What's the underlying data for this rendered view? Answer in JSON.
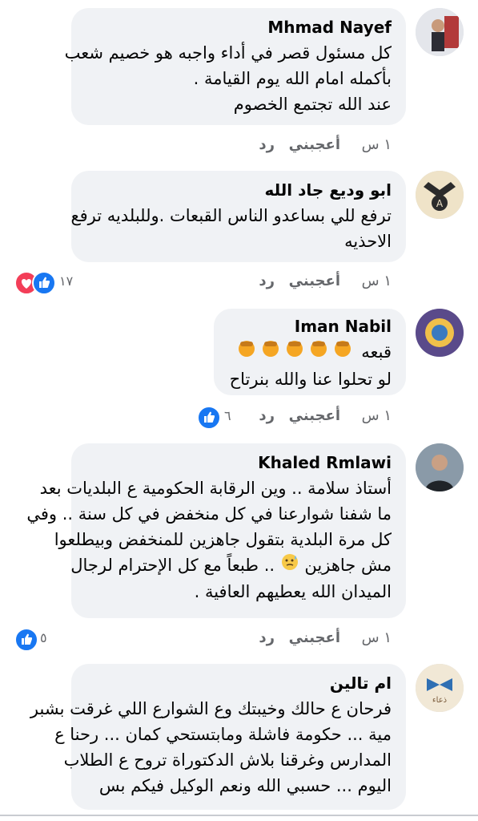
{
  "comments": [
    {
      "author": "Mhmad Nayef",
      "lines": [
        "كل مسئول قصر في أداء واجبه هو خصيم شعب",
        "بأكمله امام الله يوم القيامة .",
        "عند الله تجتمع الخصوم"
      ],
      "time": "١ س",
      "like_label": "أعجبني",
      "reply_label": "رد",
      "reaction_count": ""
    },
    {
      "author": "ابو وديع جاد الله",
      "lines": [
        "ترفع للي بساعدو الناس القبعات .وللبلديه ترفع",
        "الاحذيه"
      ],
      "time": "١ س",
      "like_label": "أعجبني",
      "reply_label": "رد",
      "reaction_count": "١٧"
    },
    {
      "author": "Iman Nabil",
      "lines": [
        "قبعه",
        "لو تحلوا عنا والله بنرتاح"
      ],
      "time": "١ س",
      "like_label": "أعجبني",
      "reply_label": "رد",
      "reaction_count": "٦"
    },
    {
      "author": "Khaled Rmlawi",
      "lines": [
        "أستاذ سلامة .. وين الرقابة الحكومية ع البلديات بعد",
        "ما شفنا شوارعنا في كل منخفض في كل سنة .. وفي",
        "كل مرة البلدية بتقول جاهزين للمنخفض وبيطلعوا",
        "مش جاهزين",
        ".. طبعاً مع كل الإحترام لرجال",
        "الميدان الله يعطيهم العافية ."
      ],
      "time": "١ س",
      "like_label": "أعجبني",
      "reply_label": "رد",
      "reaction_count": "٥"
    },
    {
      "author": "ام تالين",
      "lines": [
        "فرحان ع حالك وخيبتك وع الشوارع اللي غرقت بشبر",
        "مية ... حكومة فاشلة ومابتستحي كمان ... رحنا ع",
        "المدارس وغرقنا بلاش الدكتوراة تروح ع الطلاب",
        "اليوم ... حسبي الله ونعم الوكيل فيكم بس"
      ],
      "time": "",
      "like_label": "",
      "reply_label": "",
      "reaction_count": ""
    }
  ],
  "colors": {
    "bubble": "#f0f2f5",
    "meta": "#65676b",
    "like": "#1877f2",
    "love": "#f33e58"
  },
  "icons": {
    "like": "thumbs-up",
    "love": "heart",
    "emoji": "person-facepalming",
    "emoji2": "thinking-sweat-face"
  }
}
